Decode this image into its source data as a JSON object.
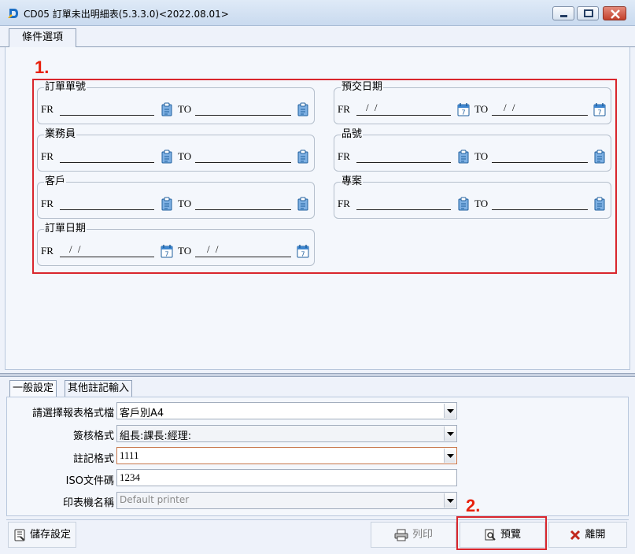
{
  "window": {
    "title": "CD05 訂單未出明細表(5.3.3.0)<2022.08.01>"
  },
  "main_tabs": [
    {
      "label": "條件選項"
    }
  ],
  "annotations": {
    "marker_1": "1.",
    "marker_2": "2.",
    "highlight_color": "#d9262d",
    "marker_color": "#e8200c"
  },
  "criteria": {
    "fr_label": "FR",
    "to_label": "TO",
    "groups": [
      {
        "title": "訂單單號",
        "fr": "",
        "to": "",
        "icon": "clipboard-icon"
      },
      {
        "title": "預交日期",
        "fr": "/ /",
        "to": "/ /",
        "icon": "calendar-icon"
      },
      {
        "title": "業務員",
        "fr": "",
        "to": "",
        "icon": "clipboard-icon"
      },
      {
        "title": "品號",
        "fr": "",
        "to": "",
        "icon": "clipboard-icon"
      },
      {
        "title": "客戶",
        "fr": "",
        "to": "",
        "icon": "clipboard-icon"
      },
      {
        "title": "專案",
        "fr": "",
        "to": "",
        "icon": "clipboard-icon"
      },
      {
        "title": "訂單日期",
        "fr": "/ /",
        "to": "/ /",
        "icon": "calendar-icon"
      }
    ]
  },
  "sub_tabs": [
    {
      "label": "一般設定"
    },
    {
      "label": "其他註記輸入"
    }
  ],
  "settings": {
    "report_format": {
      "label": "請選擇報表格式檔",
      "value": "客戶別A4"
    },
    "approval_format": {
      "label": "簽核格式",
      "value": "組長:課長:經理:"
    },
    "note_format": {
      "label": "註記格式",
      "value": "1111"
    },
    "iso_doc": {
      "label": "ISO文件碼",
      "value": "1234"
    },
    "printer": {
      "label": "印表機名稱",
      "value": "Default printer"
    }
  },
  "buttons": {
    "save_settings": "儲存設定",
    "print": "列印",
    "preview": "預覽",
    "exit": "離開"
  }
}
